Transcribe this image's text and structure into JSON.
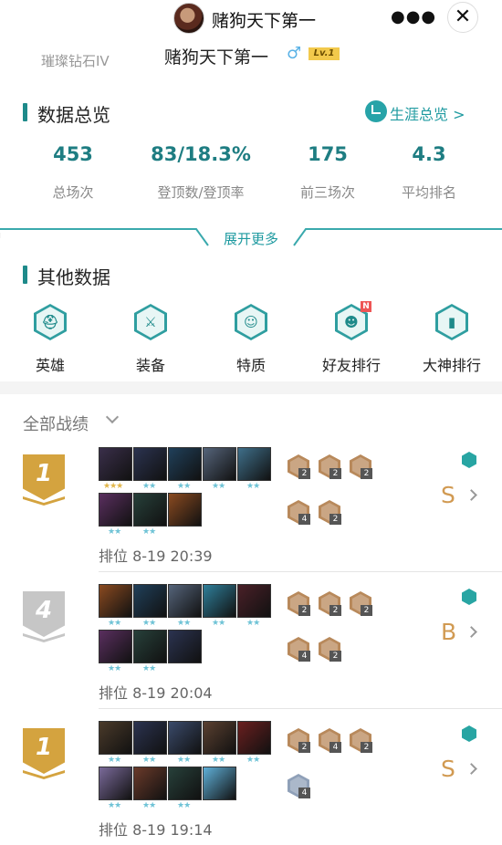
{
  "header": {
    "title": "赌狗天下第一",
    "more_icon": "more-dots-icon",
    "close_icon": "close-icon"
  },
  "profile": {
    "rank": "璀璨钻石IV",
    "name": "赌狗天下第一",
    "gender_symbol": "♂",
    "level": "Lv.1"
  },
  "overview": {
    "title": "数据总览",
    "career_link": "生涯总览 >",
    "stats": [
      {
        "value": "453",
        "label": "总场次"
      },
      {
        "value": "83/18.3%",
        "label": "登顶数/登顶率"
      },
      {
        "value": "175",
        "label": "前三场次"
      },
      {
        "value": "4.3",
        "label": "平均排名"
      }
    ],
    "expand": "展开更多"
  },
  "other": {
    "title": "其他数据",
    "items": [
      {
        "label": "英雄",
        "icon": "helmet-icon",
        "glyph": "⛑"
      },
      {
        "label": "装备",
        "icon": "armor-icon",
        "glyph": "⚔"
      },
      {
        "label": "特质",
        "icon": "mask-icon",
        "glyph": "☺"
      },
      {
        "label": "好友排行",
        "icon": "friends-icon",
        "glyph": "☻",
        "badge": "N"
      },
      {
        "label": "大神排行",
        "icon": "bar-chart-icon",
        "glyph": "▮"
      }
    ]
  },
  "filter": {
    "label": "全部战绩"
  },
  "matches": [
    {
      "place": "1",
      "grade": "S",
      "mode": "排位",
      "time": "8-19 20:39",
      "champions": [
        {
          "stars": "★★★",
          "tier": 3,
          "color": "#3a2f4a"
        },
        {
          "stars": "★★",
          "tier": 2,
          "color": "#2b3350"
        },
        {
          "stars": "★★",
          "tier": 2,
          "color": "#20405a"
        },
        {
          "stars": "★★",
          "tier": 2,
          "color": "#55647a"
        },
        {
          "stars": "★★",
          "tier": 2,
          "color": "#3f6f8a"
        },
        {
          "stars": "★★",
          "tier": 2,
          "color": "#5a2f5f"
        },
        {
          "stars": "★★",
          "tier": 2,
          "color": "#27403a"
        },
        {
          "stars": "",
          "tier": 1,
          "color": "#8a4a20"
        }
      ],
      "traits": [
        {
          "count": "2"
        },
        {
          "count": "2"
        },
        {
          "count": "2"
        },
        {
          "count": "4"
        },
        {
          "count": "2"
        }
      ]
    },
    {
      "place": "4",
      "grade": "B",
      "mode": "排位",
      "time": "8-19 20:04",
      "champions": [
        {
          "stars": "★★",
          "tier": 2,
          "color": "#8a4a20"
        },
        {
          "stars": "★★",
          "tier": 2,
          "color": "#20405a"
        },
        {
          "stars": "★★",
          "tier": 2,
          "color": "#55647a"
        },
        {
          "stars": "★★",
          "tier": 2,
          "color": "#2f7f9a"
        },
        {
          "stars": "★★",
          "tier": 2,
          "color": "#4a2028"
        },
        {
          "stars": "★★",
          "tier": 2,
          "color": "#5a2f5f"
        },
        {
          "stars": "★★",
          "tier": 2,
          "color": "#27403a"
        },
        {
          "stars": "",
          "tier": 1,
          "color": "#2b3350"
        }
      ],
      "traits": [
        {
          "count": "2"
        },
        {
          "count": "2"
        },
        {
          "count": "2"
        },
        {
          "count": "4"
        },
        {
          "count": "2"
        }
      ]
    },
    {
      "place": "1",
      "grade": "S",
      "mode": "排位",
      "time": "8-19 19:14",
      "champions": [
        {
          "stars": "★★",
          "tier": 2,
          "color": "#4a3a2a"
        },
        {
          "stars": "★★",
          "tier": 2,
          "color": "#2b3350"
        },
        {
          "stars": "★★",
          "tier": 2,
          "color": "#3a4a6a"
        },
        {
          "stars": "★★",
          "tier": 2,
          "color": "#5a4030"
        },
        {
          "stars": "★★",
          "tier": 2,
          "color": "#6a1f1f"
        },
        {
          "stars": "★★",
          "tier": 2,
          "color": "#7a6a9a"
        },
        {
          "stars": "★★",
          "tier": 2,
          "color": "#6a3a2a"
        },
        {
          "stars": "★★",
          "tier": 2,
          "color": "#27403a"
        },
        {
          "stars": "",
          "tier": 1,
          "color": "#5fb0d8"
        }
      ],
      "traits": [
        {
          "count": "2"
        },
        {
          "count": "4"
        },
        {
          "count": "2"
        },
        {
          "count": "4",
          "silver": true
        }
      ]
    }
  ],
  "colors": {
    "accent": "#1e8a8a",
    "gold": "#d4a33f",
    "silver": "#c6c6c6",
    "grade": "#d19a52"
  }
}
